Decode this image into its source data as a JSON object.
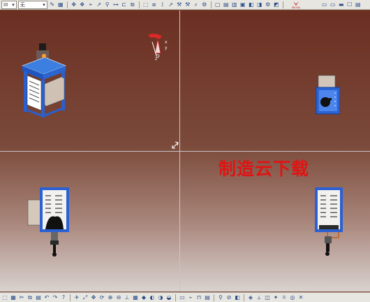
{
  "top_toolbar": {
    "combo1_value": "III",
    "combo2_value": "无",
    "logo_text": "ENOVIA"
  },
  "watermark": {
    "text": "制造云下载"
  },
  "compass": {
    "x_label": "x",
    "y_label": "y",
    "z_label": "z"
  }
}
